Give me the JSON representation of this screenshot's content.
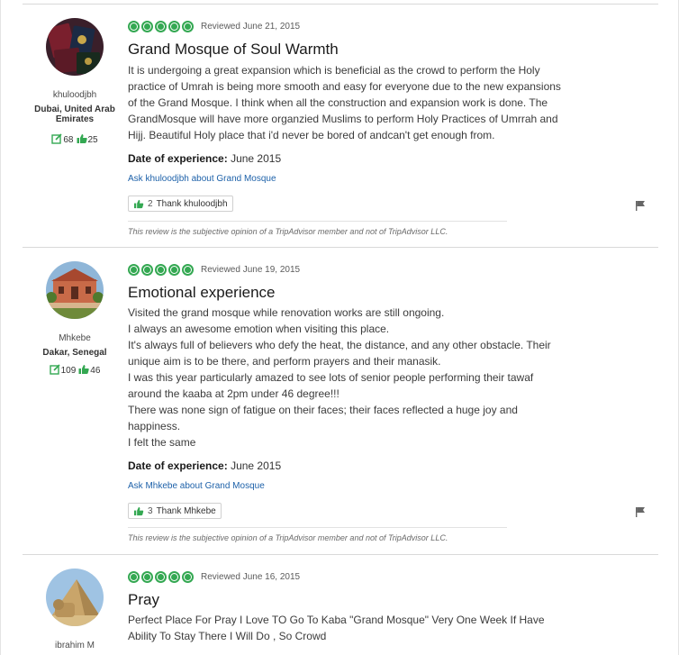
{
  "reviews": [
    {
      "avatar_icon": "passports-avatar",
      "username": "khuloodjbh",
      "location": "Dubai, United Arab Emirates",
      "location_line1": "Dubai, United Arab",
      "location_line2": "Emirates",
      "review_count": "68",
      "helpful_count": "25",
      "rating": 5,
      "reviewed_date": "Reviewed June 21, 2015",
      "title": "Grand Mosque of Soul Warmth",
      "body_lines": [
        "It is undergoing a great expansion which is beneficial as the crowd to perform the Holy",
        "practice of Umrah is being more smooth and easy for everyone due to the new expansions",
        "of the Grand Mosque. I think when all the construction and expansion work is done. The",
        "GrandMosque will have more organzied Muslims to perform Holy Practices of Umrrah and",
        "Hijj. Beautiful Holy place that i'd never be bored of andcan't get enough from."
      ],
      "date_of_experience_label": "Date of experience:",
      "date_of_experience": "June 2015",
      "ask_link": "Ask khuloodjbh about Grand Mosque",
      "thank_count": "2",
      "thank_label": "Thank khuloodjbh",
      "disclaimer": "This review is the subjective opinion of a TripAdvisor member and not of TripAdvisor LLC."
    },
    {
      "avatar_icon": "house-avatar",
      "username": "Mhkebe",
      "location": "Dakar, Senegal",
      "review_count": "109",
      "helpful_count": "46",
      "rating": 5,
      "reviewed_date": "Reviewed June 19, 2015",
      "title": "Emotional experience",
      "body_lines": [
        "Visited the grand mosque while renovation works are still ongoing.",
        "I always an awesome emotion when visiting this place.",
        "It's always full of believers who defy the heat, the distance, and any other obstacle. Their",
        "unique aim is to be there, and perform prayers and their manasik.",
        "I was this year particularly amazed to see lots of senior people performing their tawaf",
        "around the kaaba at 2pm under 46 degree!!!",
        "There was none sign of fatigue on their faces; their faces reflected a huge joy and",
        "happiness.",
        "I felt the same"
      ],
      "date_of_experience_label": "Date of experience:",
      "date_of_experience": "June 2015",
      "ask_link": "Ask Mhkebe about Grand Mosque",
      "thank_count": "3",
      "thank_label": "Thank Mhkebe",
      "disclaimer": "This review is the subjective opinion of a TripAdvisor member and not of TripAdvisor LLC."
    },
    {
      "avatar_icon": "pyramid-avatar",
      "username": "ibrahim M",
      "rating": 5,
      "reviewed_date": "Reviewed June 16, 2015",
      "title": "Pray",
      "body_lines": [
        "Perfect Place For Pray I Love TO Go To Kaba \"Grand Mosque\" Very One Week If Have",
        "Ability To Stay There I Will Do , So Crowd"
      ]
    }
  ],
  "colors": {
    "rating_green": "#34a852",
    "link_blue": "#1d61a9",
    "helpful_green": "#34a852"
  }
}
